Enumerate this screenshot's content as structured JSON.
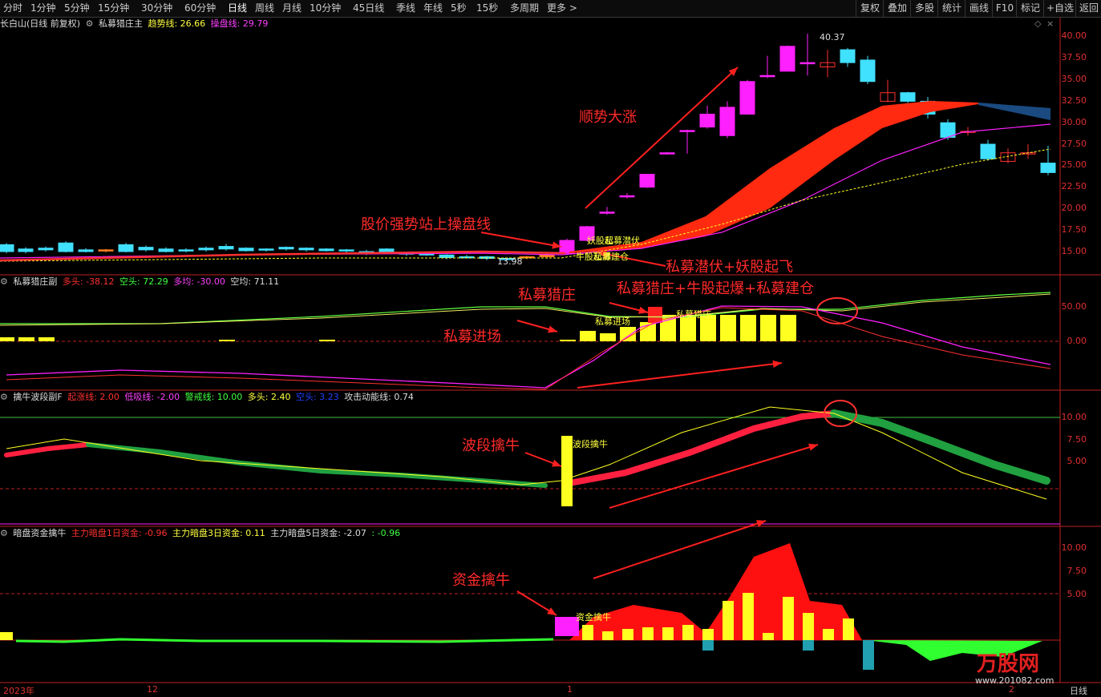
{
  "toolbar": {
    "periods": [
      "分时",
      "1分钟",
      "5分钟",
      "15分钟",
      "30分钟",
      "60分钟",
      "日线",
      "周线",
      "月线",
      "10分钟",
      "45日线",
      "季线",
      "年线",
      "5秒",
      "15秒",
      "多周期",
      "更多 >"
    ],
    "active": "日线",
    "right": [
      "复权",
      "叠加",
      "多股",
      "统计",
      "画线",
      "F10",
      "标记",
      "+自选",
      "返回"
    ]
  },
  "main_panel": {
    "title": "长白山(日线 前复权)",
    "indicator": "私募猎庄主",
    "trend_label": "趋势线: 26.66",
    "control_label": "操盘线: 29.79",
    "y_labels": [
      "40.00",
      "37.50",
      "35.00",
      "32.50",
      "30.00",
      "27.50",
      "25.00",
      "22.50",
      "20.00",
      "17.50",
      "15.00"
    ],
    "high_label": "40.37",
    "low_label": "13.98",
    "sig_yaoqi": "妖股起",
    "sig_qianfu": "私募潜伏",
    "sig_jiancang": "私募建仓",
    "sig_niugu": "牛股起爆"
  },
  "panel2": {
    "title": "私募猎庄副",
    "duotou": "多头: -38.12",
    "kongtou": "空头: 72.29",
    "duojun": "多均: -30.00",
    "kongjun": "空均: 71.11",
    "y_labels": [
      "50.00",
      "0.00"
    ],
    "sig_jinchang": "私募进场",
    "sig_liezhuang": "私募猎庄"
  },
  "panel3": {
    "title": "擒牛波段副F",
    "qizhang": "起涨线: 2.00",
    "dixian": "低吸线: -2.00",
    "jingjie": "警戒线: 10.00",
    "duotou": "多头: 2.40",
    "kongtou": "空头: 3.23",
    "gongji": "攻击动能线: 0.74",
    "y_labels": [
      "10.00",
      "7.50",
      "5.00"
    ],
    "sig_boduan": "波段擒牛"
  },
  "panel4": {
    "title": "暗盘资金擒牛",
    "d1": "主力暗盘1日资金: -0.96",
    "d3": "主力暗盘3日资金: 0.11",
    "d5": "主力暗盘5日资金: -2.07",
    "extra": ": -0.96",
    "y_labels": [
      "10.00",
      "7.50",
      "5.00"
    ],
    "sig_zijin": "资金擒牛"
  },
  "annotations": {
    "shunshi": "顺势大涨",
    "zhanshang": "股价强势站上操盘线",
    "qianfu_yao": "私募潜伏+妖股起飞",
    "liezhuang_combo": "私募猎庄+牛股起爆+私募建仓",
    "liezhuang": "私募猎庄",
    "jinchang": "私募进场",
    "boduan": "波段擒牛",
    "zijin": "资金擒牛"
  },
  "x_axis": {
    "labels": [
      "2023年",
      "12",
      "1",
      "2"
    ],
    "period_label": "日线"
  },
  "watermark": {
    "brand": "万股网",
    "url": "www.201082.com"
  },
  "colors": {
    "up": "#ff3030",
    "down": "#40e0ff",
    "magenta": "#ff20ff",
    "yellow": "#ffff20",
    "green": "#20a040"
  }
}
